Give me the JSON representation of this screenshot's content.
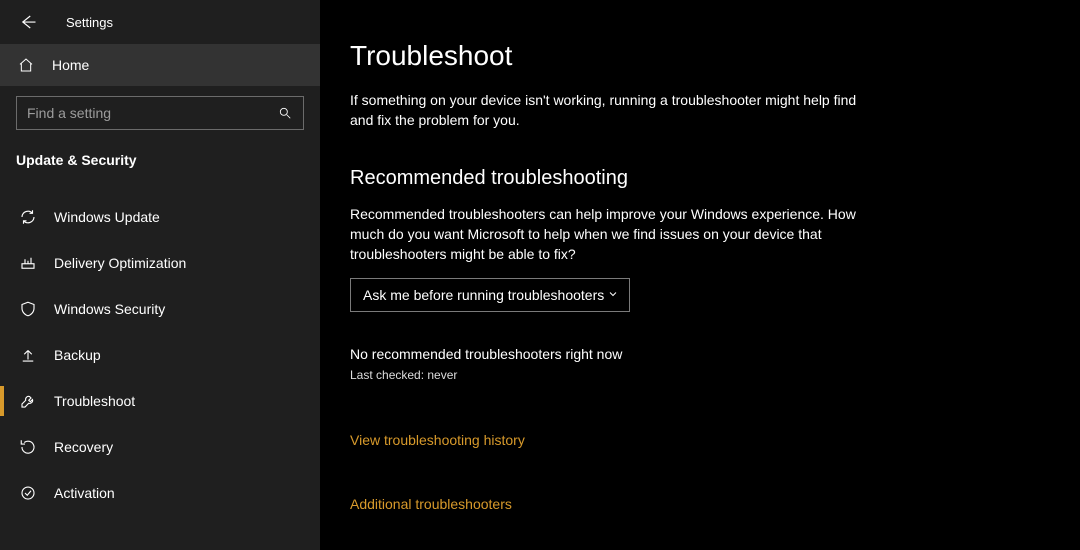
{
  "titlebar": {
    "title": "Settings"
  },
  "home": {
    "label": "Home"
  },
  "search": {
    "placeholder": "Find a setting"
  },
  "category": {
    "label": "Update & Security"
  },
  "nav": {
    "items": [
      {
        "label": "Windows Update"
      },
      {
        "label": "Delivery Optimization"
      },
      {
        "label": "Windows Security"
      },
      {
        "label": "Backup"
      },
      {
        "label": "Troubleshoot"
      },
      {
        "label": "Recovery"
      },
      {
        "label": "Activation"
      }
    ]
  },
  "main": {
    "heading": "Troubleshoot",
    "intro": "If something on your device isn't working, running a troubleshooter might help find and fix the problem for you.",
    "subheading": "Recommended troubleshooting",
    "subtext": "Recommended troubleshooters can help improve your Windows experience. How much do you want Microsoft to help when we find issues on your device that troubleshooters might be able to fix?",
    "select_value": "Ask me before running troubleshooters",
    "status": "No recommended troubleshooters right now",
    "last_checked": "Last checked: never",
    "link_history": "View troubleshooting history",
    "link_additional": "Additional troubleshooters"
  }
}
